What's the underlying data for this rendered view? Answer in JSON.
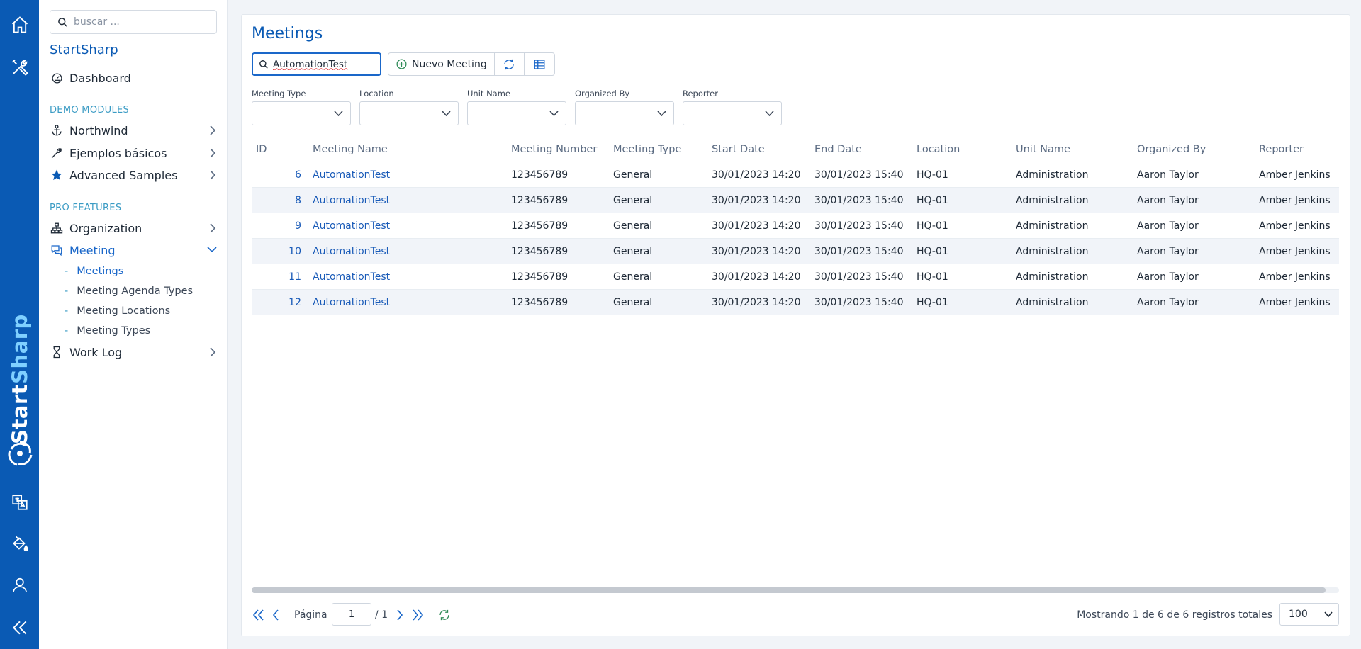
{
  "sidebar": {
    "search_placeholder": "buscar ...",
    "brand": "StartSharp",
    "dashboard": "Dashboard",
    "section_demo": "DEMO MODULES",
    "northwind": "Northwind",
    "ejemplos": "Ejemplos básicos",
    "advanced": "Advanced Samples",
    "section_pro": "PRO FEATURES",
    "organization": "Organization",
    "meeting": "Meeting",
    "sub_meetings": "Meetings",
    "sub_agenda_types": "Meeting Agenda Types",
    "sub_locations": "Meeting Locations",
    "sub_types": "Meeting Types",
    "work_log": "Work Log"
  },
  "rail": {
    "brand_start": "Start",
    "brand_end": "Sharp"
  },
  "page": {
    "title": "Meetings",
    "search_value": "AutomationTest",
    "new_button": "Nuevo Meeting"
  },
  "filters": [
    {
      "label": "Meeting Type",
      "value": ""
    },
    {
      "label": "Location",
      "value": ""
    },
    {
      "label": "Unit Name",
      "value": ""
    },
    {
      "label": "Organized By",
      "value": ""
    },
    {
      "label": "Reporter",
      "value": ""
    }
  ],
  "grid": {
    "columns": [
      "ID",
      "Meeting Name",
      "Meeting Number",
      "Meeting Type",
      "Start Date",
      "End Date",
      "Location",
      "Unit Name",
      "Organized By",
      "Reporter"
    ],
    "rows": [
      {
        "id": "6",
        "name": "AutomationTest",
        "number": "123456789",
        "type": "General",
        "start": "30/01/2023 14:20",
        "end": "30/01/2023 15:40",
        "location": "HQ-01",
        "unit": "Administration",
        "organized": "Aaron Taylor",
        "reporter": "Amber Jenkins"
      },
      {
        "id": "8",
        "name": "AutomationTest",
        "number": "123456789",
        "type": "General",
        "start": "30/01/2023 14:20",
        "end": "30/01/2023 15:40",
        "location": "HQ-01",
        "unit": "Administration",
        "organized": "Aaron Taylor",
        "reporter": "Amber Jenkins"
      },
      {
        "id": "9",
        "name": "AutomationTest",
        "number": "123456789",
        "type": "General",
        "start": "30/01/2023 14:20",
        "end": "30/01/2023 15:40",
        "location": "HQ-01",
        "unit": "Administration",
        "organized": "Aaron Taylor",
        "reporter": "Amber Jenkins"
      },
      {
        "id": "10",
        "name": "AutomationTest",
        "number": "123456789",
        "type": "General",
        "start": "30/01/2023 14:20",
        "end": "30/01/2023 15:40",
        "location": "HQ-01",
        "unit": "Administration",
        "organized": "Aaron Taylor",
        "reporter": "Amber Jenkins"
      },
      {
        "id": "11",
        "name": "AutomationTest",
        "number": "123456789",
        "type": "General",
        "start": "30/01/2023 14:20",
        "end": "30/01/2023 15:40",
        "location": "HQ-01",
        "unit": "Administration",
        "organized": "Aaron Taylor",
        "reporter": "Amber Jenkins"
      },
      {
        "id": "12",
        "name": "AutomationTest",
        "number": "123456789",
        "type": "General",
        "start": "30/01/2023 14:20",
        "end": "30/01/2023 15:40",
        "location": "HQ-01",
        "unit": "Administration",
        "organized": "Aaron Taylor",
        "reporter": "Amber Jenkins"
      }
    ]
  },
  "pager": {
    "page_label": "Página",
    "page_value": "1",
    "page_total": "/ 1",
    "status": "Mostrando 1 de 6 de 6 registros totales",
    "page_size": "100"
  }
}
